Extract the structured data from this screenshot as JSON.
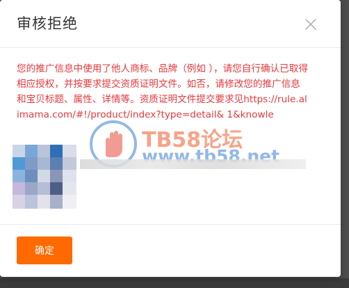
{
  "dialog": {
    "title": "审核拒绝",
    "close_label": "close",
    "message": "您的推广信息中使用了他人商标、品牌（例如                    ），请您自行确认已取得相应授权，并按要求提交资质证明文件。如否，请修改您的推广信息和宝贝标题、属性、详情等。资质证明文件提交要求见https://rule.alimama.com/#!/product/index?type=detail&                1&knowle",
    "confirm_label": "确定"
  },
  "watermark": {
    "title": "TB58论坛",
    "url": "www.tb58.net"
  },
  "colors": {
    "accent": "#ff6a00",
    "message_text": "#e4393c",
    "title_text": "#333333"
  },
  "icons": {
    "close": "close-icon",
    "watermark_logo": "hand-logo-icon"
  }
}
